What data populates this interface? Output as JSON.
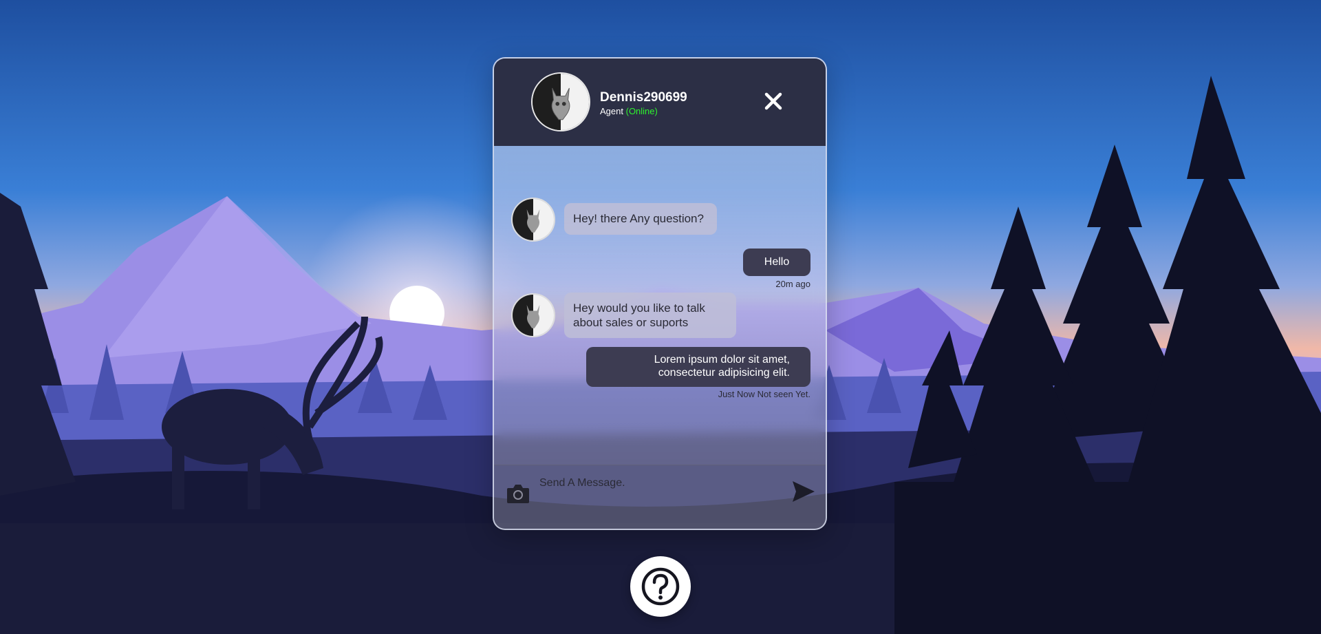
{
  "header": {
    "agent_name": "Dennis290699",
    "agent_role": "Agent",
    "agent_status": "(Online)"
  },
  "messages": [
    {
      "from": "agent",
      "text": "Hey! there Any question?"
    },
    {
      "from": "user",
      "text": "Hello",
      "meta": "20m ago"
    },
    {
      "from": "agent",
      "text": "Hey would you like to talk about sales or suports"
    },
    {
      "from": "user",
      "text": "Lorem ipsum dolor sit amet, consectetur adipisicing elit.",
      "meta": "Just Now Not seen Yet."
    }
  ],
  "input": {
    "placeholder": "Send A Message."
  },
  "icons": {
    "close": "close-icon",
    "camera": "camera-icon",
    "send": "send-icon",
    "help": "question-mark-icon",
    "avatar": "avatar-icon"
  },
  "colors": {
    "header_bg": "#2c2f45",
    "online": "#2ef52e",
    "user_bubble": "#3d3c52",
    "agent_bubble": "#bebed7"
  }
}
